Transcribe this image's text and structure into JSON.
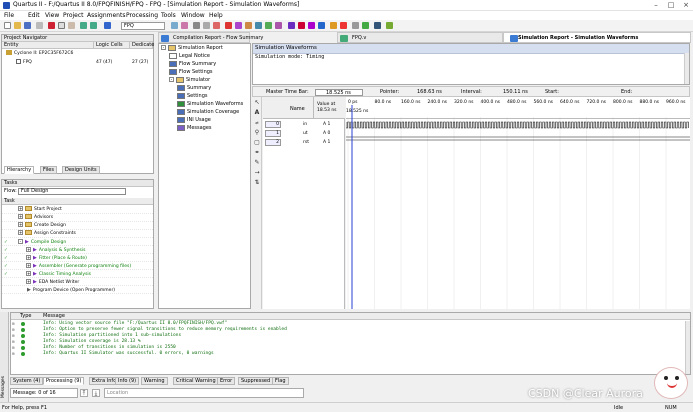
{
  "window": {
    "title": "Quartus II - F:/Quartus II 8.0/FPQFINISH/FPQ - FPQ - [Simulation Report - Simulation Waveforms]",
    "controls": [
      "–",
      "□",
      "×"
    ]
  },
  "menu": [
    "File",
    "Edit",
    "View",
    "Project",
    "Assignments",
    "Processing",
    "Tools",
    "Window",
    "Help"
  ],
  "toolbar": {
    "entity_select": "FPQ"
  },
  "project_navigator": {
    "title": "Project Navigator",
    "columns": [
      "Entity",
      "Logic Cells",
      "Dedicate"
    ],
    "rows": [
      {
        "entity": "Cyclone II: EP2C35F672C6",
        "logic": "",
        "dedicated": ""
      },
      {
        "entity": "FPQ",
        "logic": "47 (47)",
        "dedicated": "27 (27)"
      }
    ],
    "tabs": [
      "Hierarchy",
      "Files",
      "Design Units"
    ]
  },
  "tasks": {
    "title": "Tasks",
    "flow_label": "Flow:",
    "flow_value": "Full Design",
    "column": "Task",
    "rows": [
      {
        "label": "Start Project",
        "check": false,
        "expand": "+"
      },
      {
        "label": "Advisors",
        "check": false,
        "expand": "+"
      },
      {
        "label": "Create Design",
        "check": false,
        "expand": "+"
      },
      {
        "label": "Assign Constraints",
        "check": false,
        "expand": "+"
      },
      {
        "label": "Compile Design",
        "check": true,
        "expand": "-"
      },
      {
        "label": "Analysis & Synthesis",
        "check": true,
        "expand": "+"
      },
      {
        "label": "Fitter (Place & Route)",
        "check": true,
        "expand": "+"
      },
      {
        "label": "Assembler (Generate programming files)",
        "check": true,
        "expand": "+"
      },
      {
        "label": "Classic Timing Analysis",
        "check": true,
        "expand": "+"
      },
      {
        "label": "EDA Netlist Writer",
        "check": false,
        "expand": "+"
      },
      {
        "label": "Program Device (Open Programmer)",
        "check": false,
        "expand": ""
      }
    ]
  },
  "doc_tabs": [
    "Compilation Report - Flow Summary",
    "FPQ.v",
    "Simulation Report - Simulation Waveforms"
  ],
  "report_tree": [
    {
      "label": "Simulation Report",
      "level": 0,
      "type": "folder"
    },
    {
      "label": "Legal Notice",
      "level": 1,
      "type": "doc"
    },
    {
      "label": "Flow Summary",
      "level": 1,
      "type": "table"
    },
    {
      "label": "Flow Settings",
      "level": 1,
      "type": "table"
    },
    {
      "label": "Simulator",
      "level": 1,
      "type": "folder"
    },
    {
      "label": "Summary",
      "level": 2,
      "type": "table"
    },
    {
      "label": "Settings",
      "level": 2,
      "type": "table"
    },
    {
      "label": "Simulation Waveforms",
      "level": 2,
      "type": "wave"
    },
    {
      "label": "Simulation Coverage",
      "level": 2,
      "type": "table"
    },
    {
      "label": "INI Usage",
      "level": 2,
      "type": "table"
    },
    {
      "label": "Messages",
      "level": 2,
      "type": "msg"
    }
  ],
  "sim_panel": {
    "header": "Simulation Waveforms",
    "mode": "Simulation mode: Timing"
  },
  "wave_header": {
    "master_label": "Master Time Bar:",
    "master_value": "18.525 ns",
    "pointer_label": "Pointer:",
    "pointer_value": "168.63 ns",
    "interval_label": "Interval:",
    "interval_value": "150.11 ns",
    "start_label": "Start:",
    "start_value": "",
    "end_label": "End:",
    "end_value": ""
  },
  "wave_cols": {
    "name": "Name",
    "value": "Value at 18.53 ns"
  },
  "time_ticks": [
    "0 ps",
    "80.0 ns",
    "160.0 ns",
    "240.0 ns",
    "320.0 ns",
    "400.0 ns",
    "480.0 ns",
    "560.0 ns",
    "640.0 ns",
    "720.0 ns",
    "800.0 ns",
    "880.0 ns",
    "960.0 ns"
  ],
  "marker_label": "18.525 ns",
  "signals": [
    {
      "index": "0",
      "name": "in",
      "value": "A 1"
    },
    {
      "index": "1",
      "name": "ut",
      "value": "A 0"
    },
    {
      "index": "2",
      "name": "rst",
      "value": "A 1"
    }
  ],
  "messages": {
    "columns": [
      "Type",
      "Message"
    ],
    "rows": [
      "Info: Using vector source file \"F:/Quartus II 8.0/FPQFINISH/FPQ.vwf\"",
      "Info: Option to preserve fewer signal transitions to reduce memory requirements is enabled",
      "Info: Simulation partitioned into 1 sub-simulations",
      "Info: Simulation coverage is     28.13 %",
      "Info: Number of transitions in simulation is 2550",
      "Info: Quartus II Simulator was successful. 0 errors, 0 warnings"
    ],
    "tabs": [
      "System (4)",
      "Processing (9)",
      "Extra Info",
      "Info (9)",
      "Warning",
      "Critical Warning",
      "Error",
      "Suppressed",
      "Flag"
    ],
    "status": "Message: 0 of 16",
    "location_placeholder": "Location"
  },
  "statusbar": {
    "help": "For Help, press F1",
    "state": "Idle",
    "mode": "NUM"
  },
  "watermark": "CSDN @Clear Aurora",
  "side_label": "Messages"
}
